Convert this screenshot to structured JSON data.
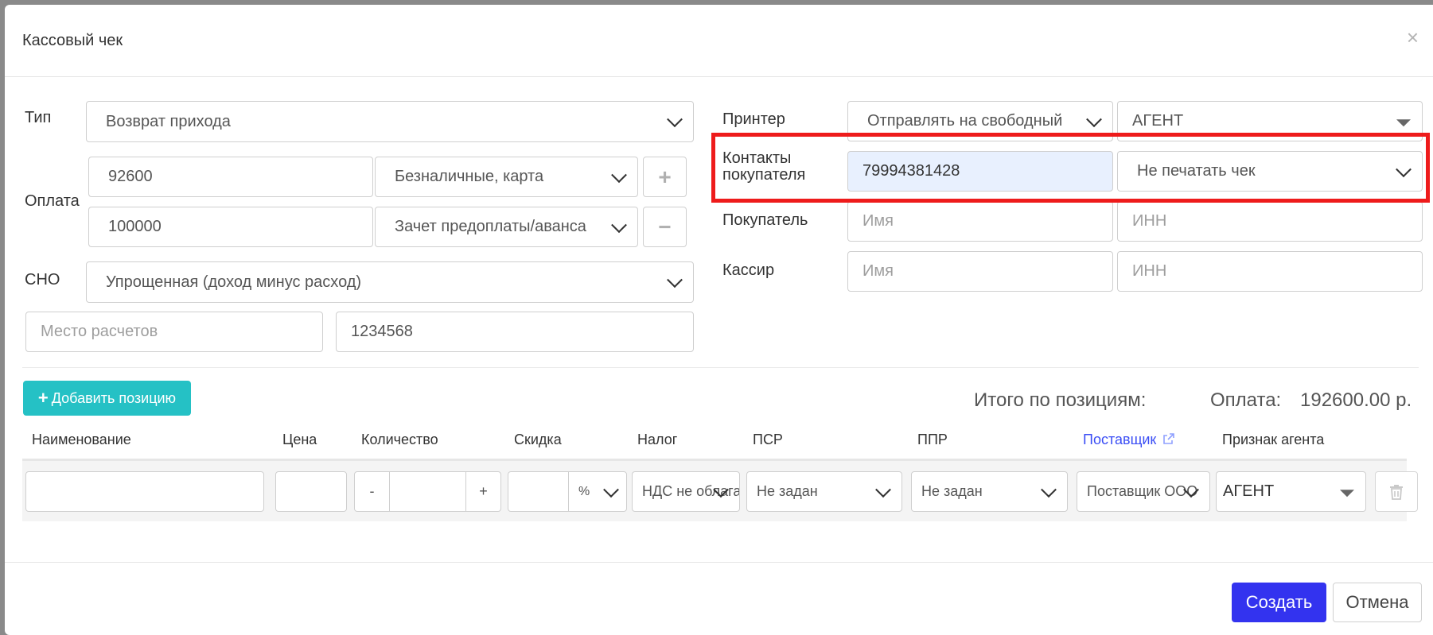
{
  "modal": {
    "title": "Кассовый чек",
    "close": "×"
  },
  "left": {
    "type_label": "Тип",
    "type_value": "Возврат прихода",
    "payment_label": "Оплата",
    "payments": [
      {
        "amount": "92600",
        "method": "Безналичные, карта",
        "action": "+"
      },
      {
        "amount": "100000",
        "method": "Зачет предоплаты/аванса",
        "action": "−"
      }
    ],
    "sno_label": "СНО",
    "sno_value": "Упрощенная (доход минус расход)",
    "place_placeholder": "Место расчетов",
    "place_code": "1234568"
  },
  "right": {
    "printer_label": "Принтер",
    "printer_value": "Отправлять на свободный",
    "printer_agent": "АГЕНТ",
    "contacts_label_1": "Контакты",
    "contacts_label_2": "покупателя",
    "contacts_value": "79994381428",
    "print_option": "Не печатать чек",
    "buyer_label": "Покупатель",
    "buyer_name_placeholder": "Имя",
    "buyer_inn_placeholder": "ИНН",
    "cashier_label": "Кассир",
    "cashier_name_placeholder": "Имя",
    "cashier_inn_placeholder": "ИНН"
  },
  "positions": {
    "add_button": "Добавить позицию",
    "total_label": "Итого по позициям:",
    "payment_label": "Оплата:",
    "payment_value": "192600.00 р.",
    "columns": [
      "Наименование",
      "Цена",
      "Количество",
      "Скидка",
      "Налог",
      "ПСР",
      "ППР",
      "Поставщик",
      "Признак агента"
    ],
    "row": {
      "minus": "-",
      "plus": "+",
      "discount_unit": "%",
      "tax": "НДС не облагается",
      "psr": "Не задан",
      "ppr": "Не задан",
      "supplier": "Поставщик ООО",
      "agent": "АГЕНТ"
    }
  },
  "footer": {
    "create": "Создать",
    "cancel": "Отмена"
  }
}
